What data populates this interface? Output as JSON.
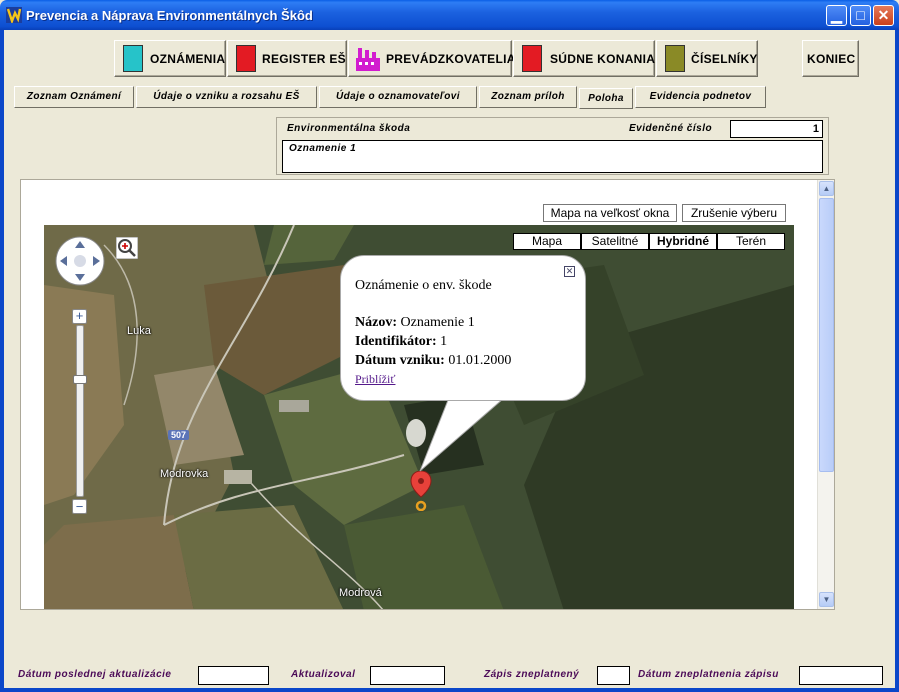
{
  "window": {
    "title": "Prevencia a Náprava Environmentálnych Škôd",
    "minimize_glyph": "▁",
    "maximize_glyph": "□",
    "close_glyph": "✕"
  },
  "toolbar": {
    "oznamenia": "OZNÁMENIA",
    "register": "REGISTER EŠ",
    "prevadzkovatelia": "PREVÁDZKOVATELIA",
    "sudne": "SÚDNE KONANIA",
    "ciselniky": "ČÍSELNÍKY",
    "koniec": "KONIEC"
  },
  "tabs": {
    "zoznam_oznameni": "Zoznam Oznámení",
    "udaje_vzniku": "Údaje o vzniku a rozsahu EŠ",
    "udaje_oznamovatel": "Údaje o oznamovateľovi",
    "zoznam_priloh": "Zoznam príloh",
    "poloha": "Poloha",
    "evidencia": "Evidencia podnetov"
  },
  "header": {
    "env_label": "Environmentálna škoda",
    "evid_label": "Evidenčné číslo",
    "evid_value": "1",
    "name_value": "Oznamenie 1"
  },
  "map": {
    "btn_fullsize": "Mapa na veľkosť okna",
    "btn_clear": "Zrušenie výberu",
    "types": {
      "mapa": "Mapa",
      "satelitne": "Satelitné",
      "hybridne": "Hybridné",
      "teren": "Terén"
    },
    "places": {
      "luka": "Luka",
      "modrovka": "Modrovka",
      "modrova": "Modrová",
      "road": "507"
    },
    "popup": {
      "title": "Oznámenie o env. škode",
      "name_label": "Názov:",
      "name_value": "Oznamenie 1",
      "id_label": "Identifikátor:",
      "id_value": "1",
      "date_label": "Dátum vzniku:",
      "date_value": "01.01.2000",
      "zoom_link": "Priblížiť"
    }
  },
  "footer": {
    "last_update": "Dátum poslednej aktualizácie",
    "updated_by": "Aktualizoval",
    "invalid": "Zápis zneplatnený",
    "invalid_date": "Dátum zneplatnenia zápisu"
  },
  "colors": {
    "titlebar": "#0d4fd1",
    "face": "#ece9d8",
    "footer_label": "#4b0a57",
    "marker": "#e8413a"
  }
}
